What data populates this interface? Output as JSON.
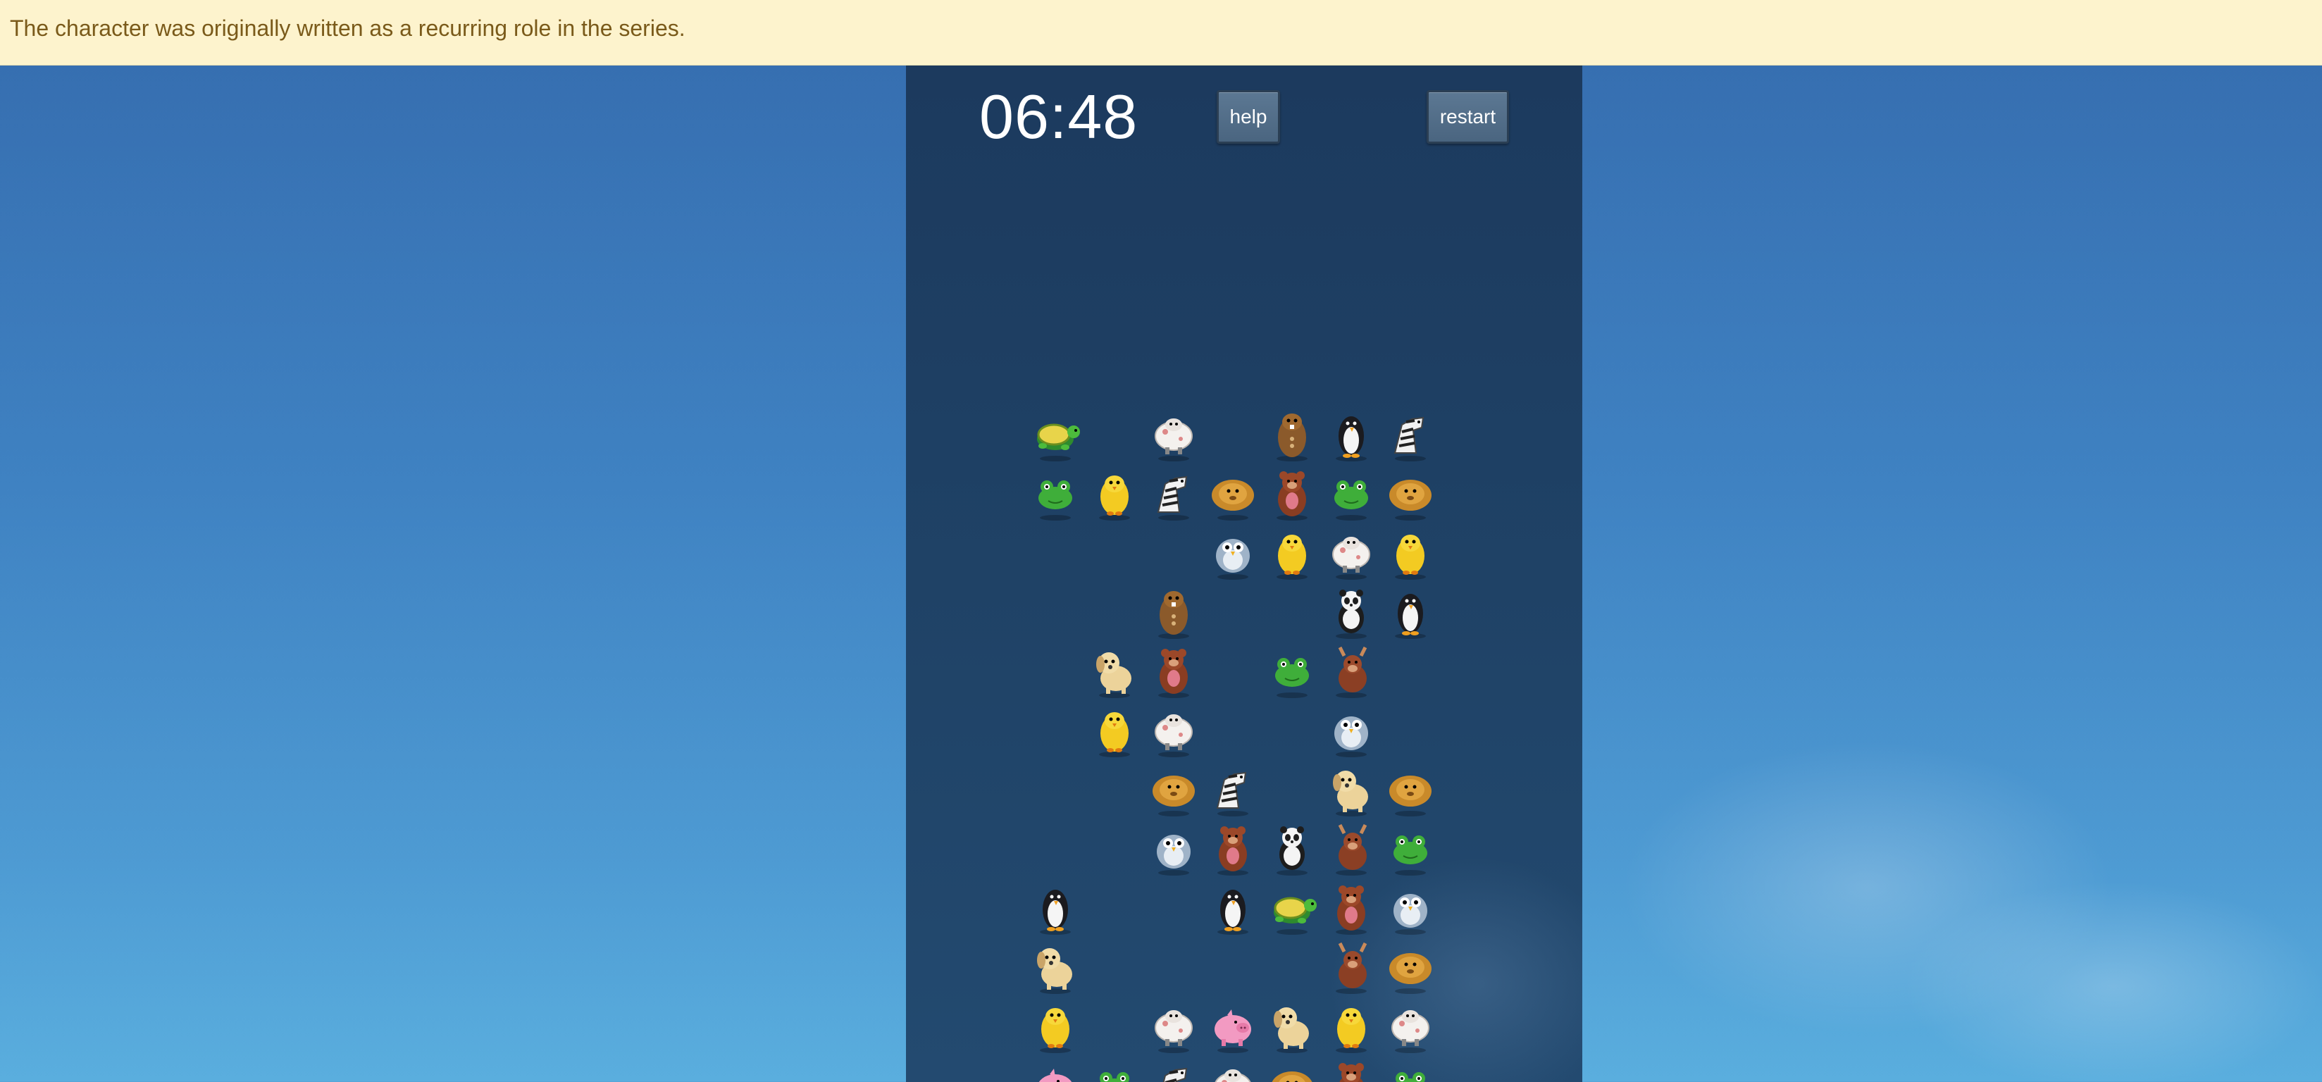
{
  "banner": {
    "text": "The character was originally written as a recurring role in the series."
  },
  "game": {
    "timer": "06:48",
    "help_label": "help",
    "restart_label": "restart"
  },
  "colors": {
    "banner_bg": "#fdf3cd",
    "banner_text": "#7a5a1a",
    "panel_bg": "#1f4266",
    "button_bg": "#526e8a"
  },
  "tiles": [
    {
      "row": 0,
      "col": 0,
      "animal": "turtle"
    },
    {
      "row": 0,
      "col": 2,
      "animal": "sheep"
    },
    {
      "row": 0,
      "col": 4,
      "animal": "beaver"
    },
    {
      "row": 0,
      "col": 5,
      "animal": "penguin"
    },
    {
      "row": 0,
      "col": 6,
      "animal": "zebra"
    },
    {
      "row": 1,
      "col": 0,
      "animal": "frog"
    },
    {
      "row": 1,
      "col": 1,
      "animal": "chick"
    },
    {
      "row": 1,
      "col": 2,
      "animal": "zebra"
    },
    {
      "row": 1,
      "col": 3,
      "animal": "lion"
    },
    {
      "row": 1,
      "col": 4,
      "animal": "bear"
    },
    {
      "row": 1,
      "col": 5,
      "animal": "frog"
    },
    {
      "row": 1,
      "col": 6,
      "animal": "lion"
    },
    {
      "row": 2,
      "col": 3,
      "animal": "owl"
    },
    {
      "row": 2,
      "col": 4,
      "animal": "chick"
    },
    {
      "row": 2,
      "col": 5,
      "animal": "sheep"
    },
    {
      "row": 2,
      "col": 6,
      "animal": "chick"
    },
    {
      "row": 3,
      "col": 2,
      "animal": "beaver"
    },
    {
      "row": 3,
      "col": 5,
      "animal": "panda"
    },
    {
      "row": 3,
      "col": 6,
      "animal": "penguin"
    },
    {
      "row": 4,
      "col": 1,
      "animal": "dog"
    },
    {
      "row": 4,
      "col": 2,
      "animal": "bear"
    },
    {
      "row": 4,
      "col": 4,
      "animal": "frog"
    },
    {
      "row": 4,
      "col": 5,
      "animal": "moose"
    },
    {
      "row": 5,
      "col": 1,
      "animal": "chick"
    },
    {
      "row": 5,
      "col": 2,
      "animal": "sheep"
    },
    {
      "row": 5,
      "col": 5,
      "animal": "owl"
    },
    {
      "row": 6,
      "col": 2,
      "animal": "lion"
    },
    {
      "row": 6,
      "col": 3,
      "animal": "zebra"
    },
    {
      "row": 6,
      "col": 5,
      "animal": "dog"
    },
    {
      "row": 6,
      "col": 6,
      "animal": "lion"
    },
    {
      "row": 7,
      "col": 2,
      "animal": "owl"
    },
    {
      "row": 7,
      "col": 3,
      "animal": "bear"
    },
    {
      "row": 7,
      "col": 4,
      "animal": "panda"
    },
    {
      "row": 7,
      "col": 5,
      "animal": "moose"
    },
    {
      "row": 7,
      "col": 6,
      "animal": "frog"
    },
    {
      "row": 8,
      "col": 0,
      "animal": "penguin"
    },
    {
      "row": 8,
      "col": 3,
      "animal": "penguin"
    },
    {
      "row": 8,
      "col": 4,
      "animal": "turtle"
    },
    {
      "row": 8,
      "col": 5,
      "animal": "bear"
    },
    {
      "row": 8,
      "col": 6,
      "animal": "owl"
    },
    {
      "row": 9,
      "col": 0,
      "animal": "dog"
    },
    {
      "row": 9,
      "col": 5,
      "animal": "moose"
    },
    {
      "row": 9,
      "col": 6,
      "animal": "lion"
    },
    {
      "row": 10,
      "col": 0,
      "animal": "chick"
    },
    {
      "row": 10,
      "col": 2,
      "animal": "sheep"
    },
    {
      "row": 10,
      "col": 3,
      "animal": "pig"
    },
    {
      "row": 10,
      "col": 4,
      "animal": "dog"
    },
    {
      "row": 10,
      "col": 5,
      "animal": "chick"
    },
    {
      "row": 10,
      "col": 6,
      "animal": "sheep"
    },
    {
      "row": 11,
      "col": 0,
      "animal": "pig"
    },
    {
      "row": 11,
      "col": 1,
      "animal": "frog"
    },
    {
      "row": 11,
      "col": 2,
      "animal": "zebra"
    },
    {
      "row": 11,
      "col": 3,
      "animal": "sheep"
    },
    {
      "row": 11,
      "col": 4,
      "animal": "lion"
    },
    {
      "row": 11,
      "col": 5,
      "animal": "bear"
    },
    {
      "row": 11,
      "col": 6,
      "animal": "frog"
    }
  ]
}
